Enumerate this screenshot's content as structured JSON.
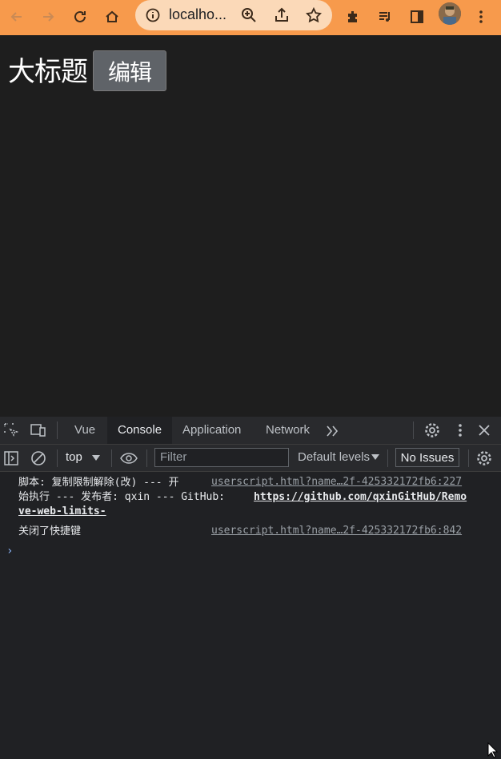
{
  "browser": {
    "url": "localho...",
    "icons": [
      "back-icon",
      "forward-icon",
      "reload-icon",
      "home-icon",
      "info-icon",
      "zoom-icon",
      "share-icon",
      "star-icon",
      "extensions-icon",
      "media-icon",
      "sidepanel-icon",
      "avatar",
      "menu-icon"
    ]
  },
  "page": {
    "heading": "大标题",
    "edit_label": "编辑"
  },
  "devtools": {
    "tabs": [
      "Vue",
      "Console",
      "Application",
      "Network"
    ],
    "active_tab": "Console",
    "context": "top",
    "filter_placeholder": "Filter",
    "levels": "Default levels",
    "issues": "No Issues",
    "messages": [
      {
        "line1": "脚本: 复制限制解除(改) --- 开",
        "line2": "始执行 --- 发布者: qxin --- GitHub: ",
        "link_part1": "https://github.com/qxinGitHub/Remo",
        "link_part2": "ve-web-limits-",
        "source": "userscript.html?name…2f-425332172fb6:227"
      },
      {
        "text": "关闭了快捷键",
        "source": "userscript.html?name…2f-425332172fb6:842"
      }
    ],
    "prompt": "›"
  }
}
